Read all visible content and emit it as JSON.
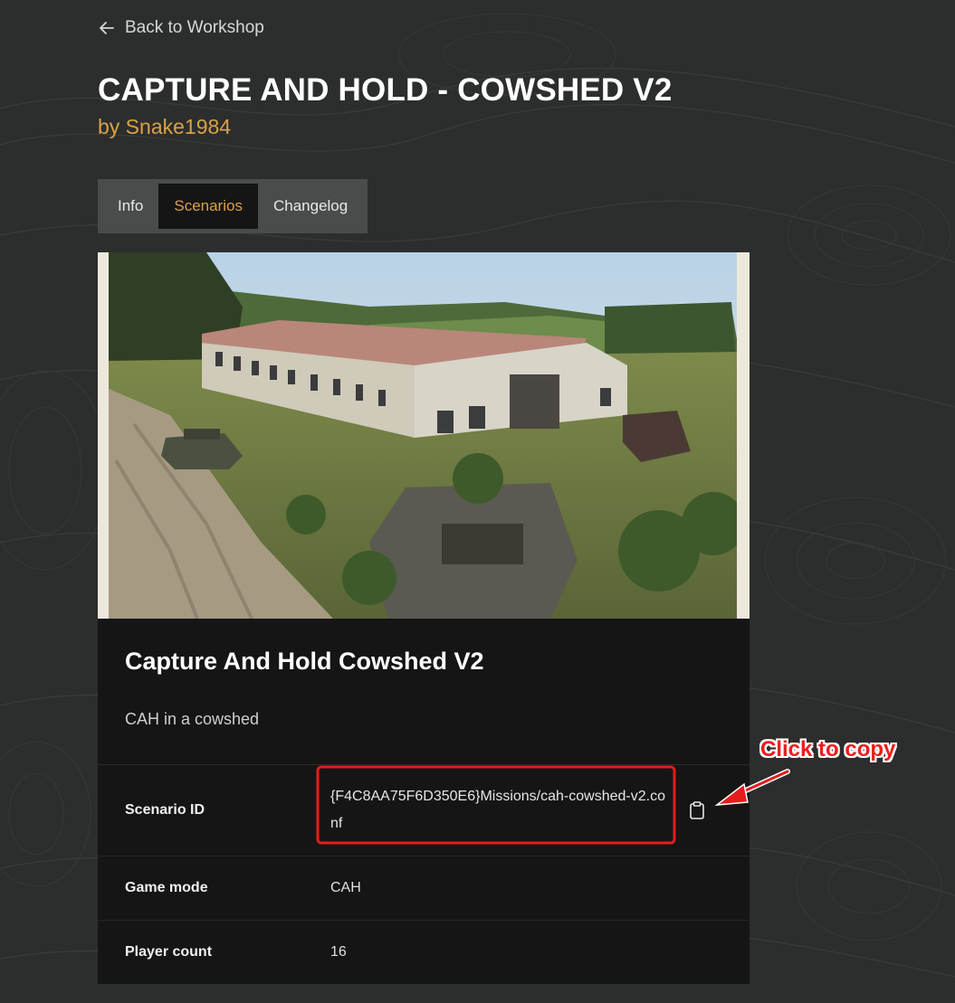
{
  "nav": {
    "back_label": "Back to Workshop"
  },
  "header": {
    "title": "CAPTURE AND HOLD - COWSHED V2",
    "author": "by Snake1984"
  },
  "tabs": [
    {
      "label": "Info",
      "active": false
    },
    {
      "label": "Scenarios",
      "active": true
    },
    {
      "label": "Changelog",
      "active": false
    }
  ],
  "scenario": {
    "title": "Capture And Hold Cowshed V2",
    "description": "CAH in a cowshed",
    "details": [
      {
        "label": "Scenario ID",
        "value": "{F4C8AA75F6D350E6}Missions/cah-cowshed-v2.conf"
      },
      {
        "label": "Game mode",
        "value": "CAH"
      },
      {
        "label": "Player count",
        "value": "16"
      }
    ]
  },
  "annotation": {
    "text": "Click to copy",
    "color": "#ee1c1c"
  },
  "icons": {
    "back": "arrow-left-icon",
    "copy": "clipboard-icon"
  },
  "colors": {
    "accent": "#d9a14a",
    "card": "#151515",
    "background": "#2b2d2c"
  }
}
